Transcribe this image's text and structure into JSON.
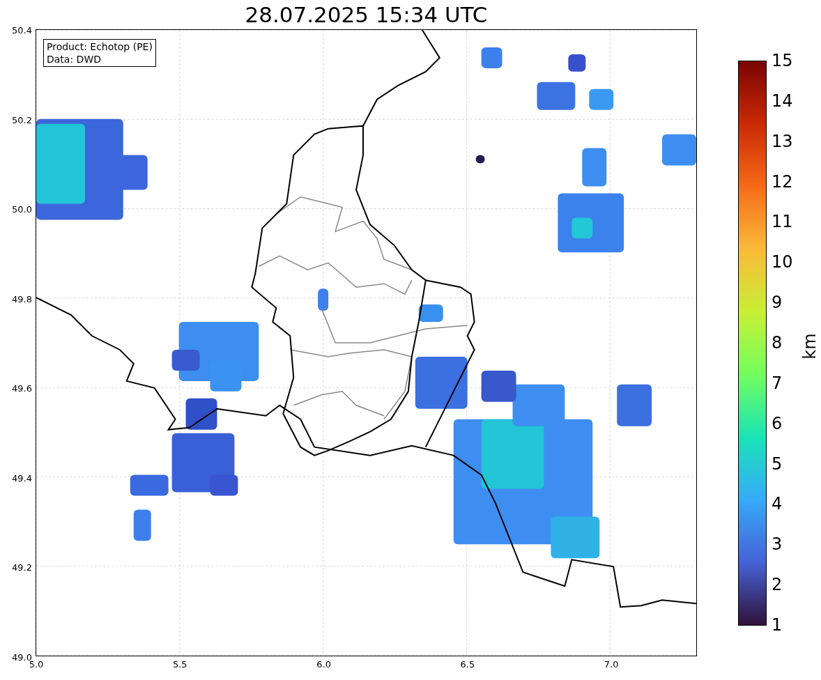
{
  "title": "28.07.2025 15:34 UTC",
  "legend": [
    "Product: Echotop (PE)",
    "Data: DWD"
  ],
  "map": {
    "kind": "map",
    "xticks": [
      "5.0",
      "5.5",
      "6.0",
      "6.5",
      "7.0"
    ],
    "yticks": [
      "50.4",
      "50.2",
      "50.0",
      "49.8",
      "49.6",
      "49.4",
      "49.2",
      "49.0"
    ]
  },
  "colorbar": {
    "label": "km",
    "ticks": [
      "15",
      "14",
      "13",
      "12",
      "11",
      "10",
      "9",
      "8",
      "7",
      "6",
      "5",
      "4",
      "3",
      "2",
      "1"
    ]
  }
}
